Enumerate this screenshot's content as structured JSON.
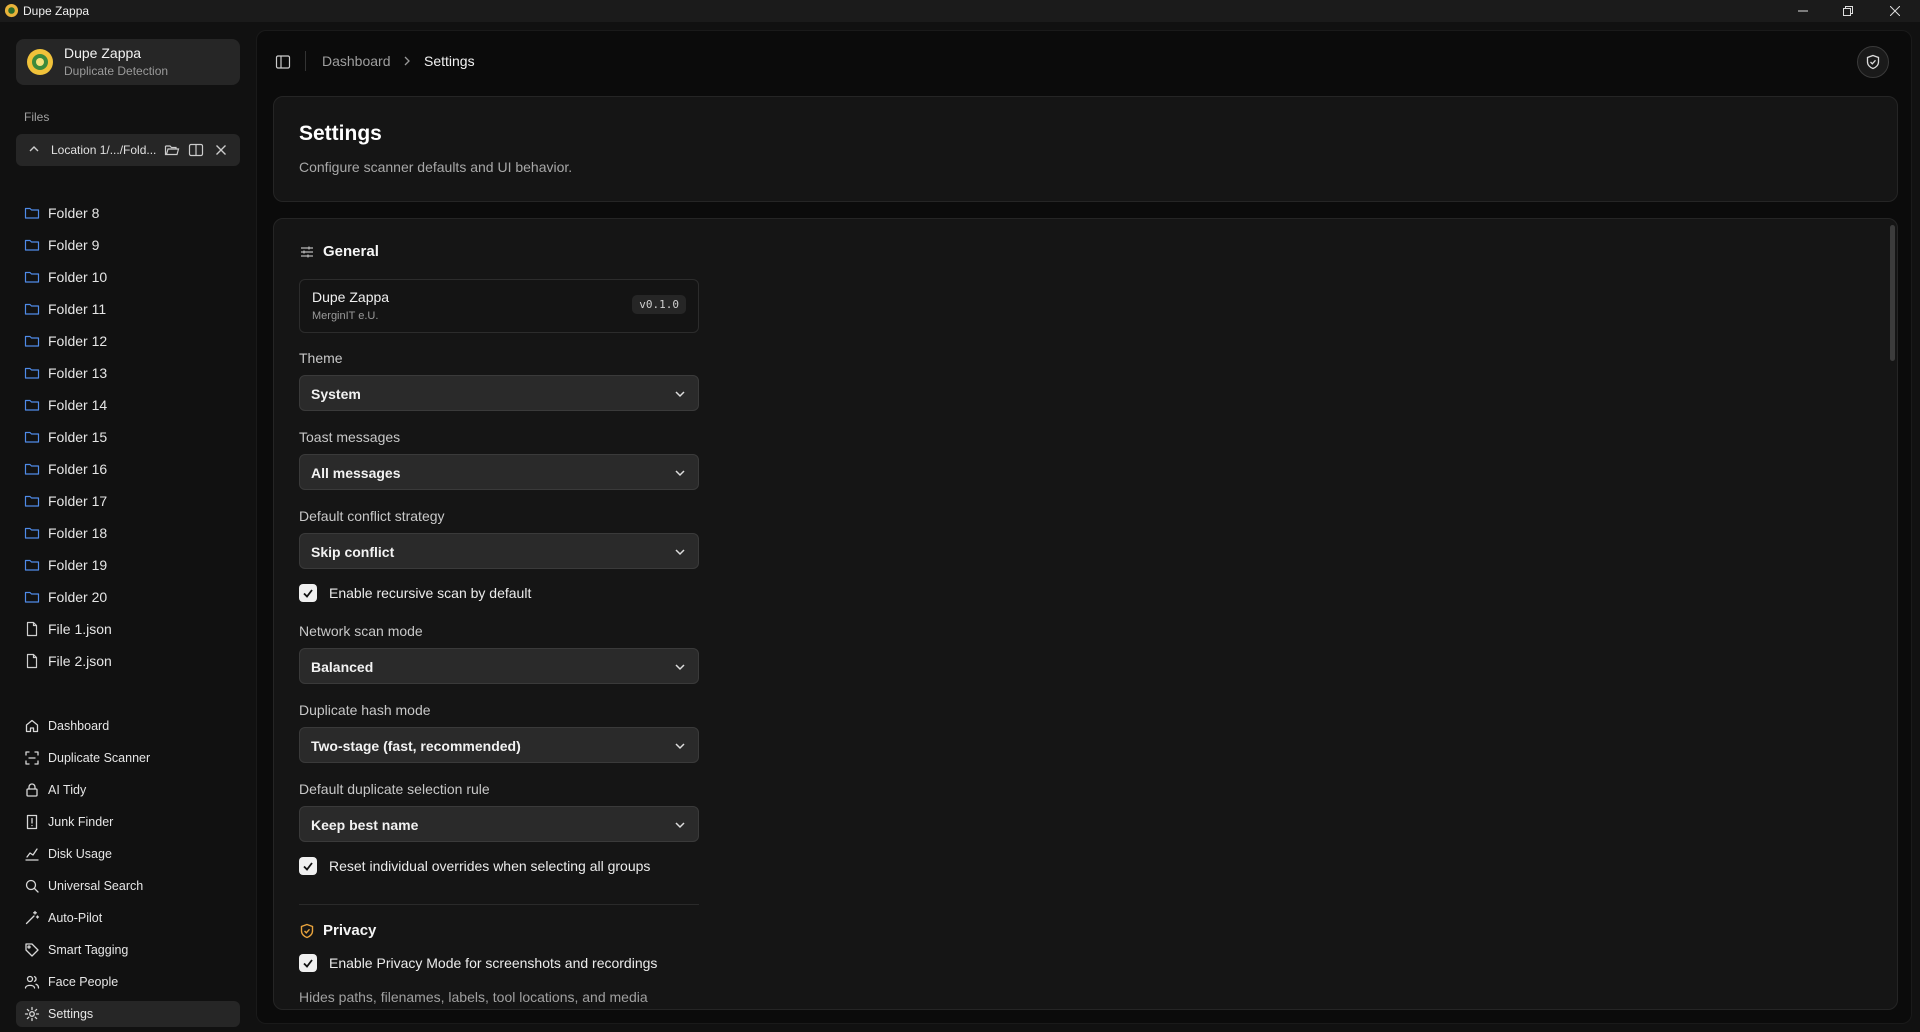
{
  "window": {
    "title": "Dupe Zappa"
  },
  "sidebar": {
    "app_name": "Dupe Zappa",
    "app_subtitle": "Duplicate Detection",
    "files_label": "Files",
    "location_text": "Location 1/.../Fold...",
    "tree": [
      {
        "label": "Folder 8",
        "type": "folder"
      },
      {
        "label": "Folder 9",
        "type": "folder"
      },
      {
        "label": "Folder 10",
        "type": "folder"
      },
      {
        "label": "Folder 11",
        "type": "folder"
      },
      {
        "label": "Folder 12",
        "type": "folder"
      },
      {
        "label": "Folder 13",
        "type": "folder"
      },
      {
        "label": "Folder 14",
        "type": "folder"
      },
      {
        "label": "Folder 15",
        "type": "folder"
      },
      {
        "label": "Folder 16",
        "type": "folder"
      },
      {
        "label": "Folder 17",
        "type": "folder"
      },
      {
        "label": "Folder 18",
        "type": "folder"
      },
      {
        "label": "Folder 19",
        "type": "folder"
      },
      {
        "label": "Folder 20",
        "type": "folder"
      },
      {
        "label": "File 1.json",
        "type": "file"
      },
      {
        "label": "File 2.json",
        "type": "file"
      }
    ],
    "nav": [
      {
        "label": "Dashboard",
        "icon": "home-icon"
      },
      {
        "label": "Duplicate Scanner",
        "icon": "scan-icon"
      },
      {
        "label": "AI Tidy",
        "icon": "lock-icon"
      },
      {
        "label": "Junk Finder",
        "icon": "alert-file-icon"
      },
      {
        "label": "Disk Usage",
        "icon": "chart-icon"
      },
      {
        "label": "Universal Search",
        "icon": "search-icon"
      },
      {
        "label": "Auto-Pilot",
        "icon": "wand-icon"
      },
      {
        "label": "Smart Tagging",
        "icon": "tag-icon"
      },
      {
        "label": "Face People",
        "icon": "people-icon"
      },
      {
        "label": "Settings",
        "icon": "gear-icon",
        "active": true
      }
    ]
  },
  "header": {
    "breadcrumb_parent": "Dashboard",
    "breadcrumb_current": "Settings"
  },
  "page": {
    "title": "Settings",
    "description": "Configure scanner defaults and UI behavior."
  },
  "general": {
    "title": "General",
    "app_name": "Dupe Zappa",
    "company": "MerginIT e.U.",
    "version": "v0.1.0",
    "theme_label": "Theme",
    "theme_value": "System",
    "toast_label": "Toast messages",
    "toast_value": "All messages",
    "conflict_label": "Default conflict strategy",
    "conflict_value": "Skip conflict",
    "recursive_label": "Enable recursive scan by default",
    "recursive_checked": true,
    "network_label": "Network scan mode",
    "network_value": "Balanced",
    "hash_label": "Duplicate hash mode",
    "hash_value": "Two-stage (fast, recommended)",
    "selection_label": "Default duplicate selection rule",
    "selection_value": "Keep best name",
    "reset_label": "Reset individual overrides when selecting all groups",
    "reset_checked": true
  },
  "privacy": {
    "title": "Privacy",
    "privacy_mode_label": "Enable Privacy Mode for screenshots and recordings",
    "privacy_mode_checked": true,
    "hint": "Hides paths, filenames, labels, tool locations, and media"
  },
  "colors": {
    "background": "#111111",
    "panel": "#0b0b0b",
    "card": "#151515",
    "privacy_accent": "#e8a33d",
    "folder_icon": "#4f8be8"
  }
}
